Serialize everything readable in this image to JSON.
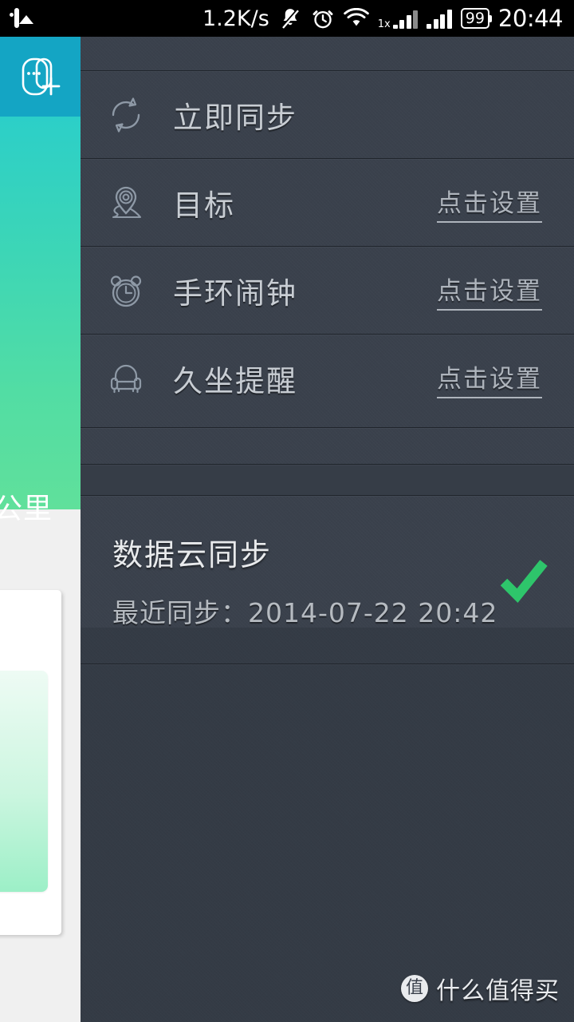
{
  "status_bar": {
    "gallery_icon": "photo-icon",
    "network_speed": "1.2K/s",
    "mute_icon": "bell-muted-icon",
    "alarm_icon": "alarm-clock-icon",
    "wifi_icon": "wifi-icon",
    "onex_label": "1x",
    "signal_icon": "signal-bars-icon",
    "battery_level": "99",
    "clock": "20:44"
  },
  "behind_screen": {
    "band_icon": "fitness-band-add-icon",
    "unit_label": "公里"
  },
  "panel": {
    "menu": [
      {
        "icon": "sync-refresh-icon",
        "label": "立即同步",
        "action": ""
      },
      {
        "icon": "map-pin-target-icon",
        "label": "目标",
        "action": "点击设置"
      },
      {
        "icon": "alarm-clock-icon",
        "label": "手环闹钟",
        "action": "点击设置"
      },
      {
        "icon": "armchair-icon",
        "label": "久坐提醒",
        "action": "点击设置"
      }
    ],
    "cloud_sync": {
      "title": "数据云同步",
      "last_sync": "最近同步：2014-07-22 20:42",
      "status_icon": "green-check-icon"
    }
  },
  "watermark": {
    "logo_char": "值",
    "text": "什么值得买"
  },
  "colors": {
    "panel_bg": "#3a414c",
    "panel_bg_lower": "#343b45",
    "divider": "#20252c",
    "label": "#c8cdd3",
    "action_link": "#aeb4bc",
    "icon_stroke": "#8e99a6",
    "accent_check": "#2ec56b",
    "band_header": "#14a5c4",
    "gradient_top": "#2ccfc8",
    "gradient_bottom": "#60e09b",
    "status_bar_bg": "#000000"
  }
}
